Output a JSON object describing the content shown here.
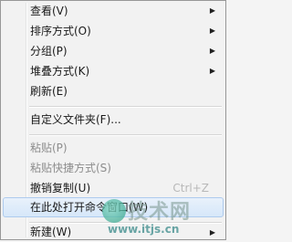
{
  "menu": {
    "items": [
      {
        "label": "查看(V)",
        "submenu": true
      },
      {
        "label": "排序方式(O)",
        "submenu": true
      },
      {
        "label": "分组(P)",
        "submenu": true
      },
      {
        "label": "堆叠方式(K)",
        "submenu": true
      },
      {
        "label": "刷新(E)"
      },
      {
        "label": "自定义文件夹(F)..."
      },
      {
        "label": "粘贴(P)",
        "disabled": true
      },
      {
        "label": "粘贴快捷方式(S)",
        "disabled": true
      },
      {
        "label": "撤销复制(U)",
        "shortcut": "Ctrl+Z"
      },
      {
        "label": "在此处打开命令窗口(W)",
        "highlighted": true
      },
      {
        "label": "新建(W)",
        "submenu": true
      }
    ]
  },
  "icons": {
    "submenu_arrow": "triangle-right-icon"
  },
  "colors": {
    "highlight_border": "#aecbee",
    "disabled_text": "#8d8d8d"
  },
  "watermark": {
    "big_text": "技术网",
    "url": "www.itjs.cn"
  }
}
